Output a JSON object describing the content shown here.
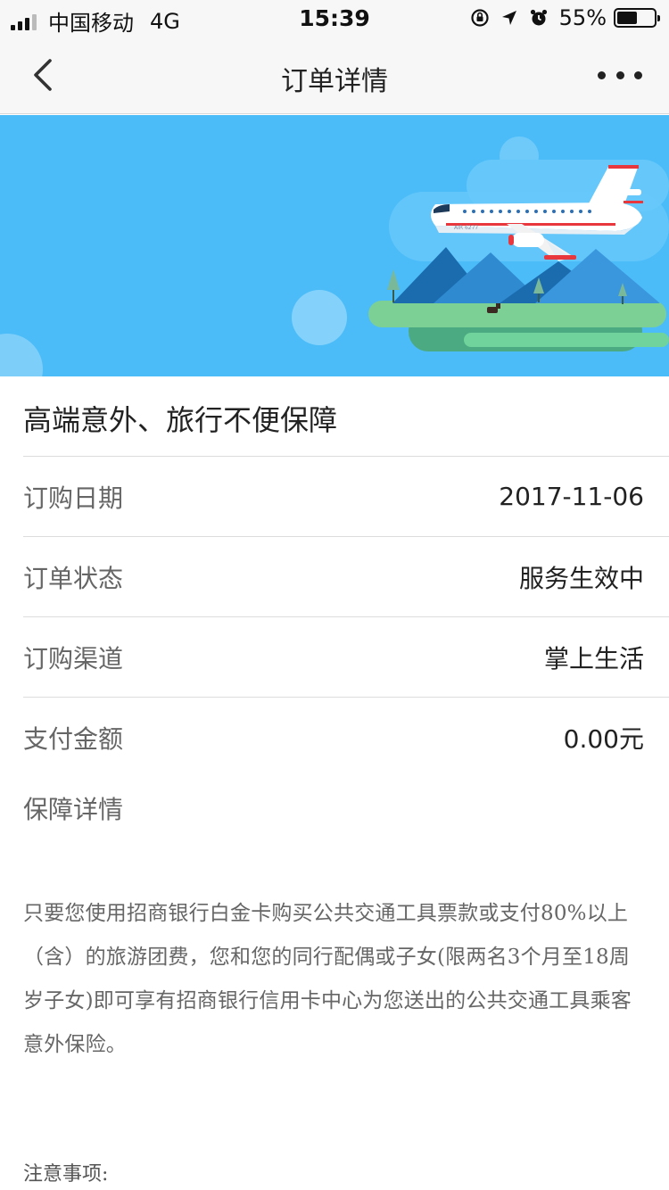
{
  "status_bar": {
    "carrier": "中国移动",
    "network": "4G",
    "time": "15:39",
    "battery_percent": "55%",
    "battery_level": 0.55
  },
  "nav": {
    "title": "订单详情"
  },
  "order": {
    "product_name": "高端意外、旅行不便保障",
    "rows": [
      {
        "label": "订购日期",
        "value": "2017-11-06"
      },
      {
        "label": "订单状态",
        "value": "服务生效中"
      },
      {
        "label": "订购渠道",
        "value": "掌上生活"
      },
      {
        "label": "支付金额",
        "value": "0.00元"
      }
    ],
    "coverage_title": "保障详情",
    "coverage_text": "只要您使用招商银行白金卡购买公共交通工具票款或支付80%以上（含）的旅游团费，您和您的同行配偶或子女(限两名3个月至18周岁子女)即可享有招商银行信用卡中心为您送出的公共交通工具乘客意外保险。",
    "notice_title": "注意事项:"
  },
  "banner": {
    "plane_text": "AIR 6277"
  },
  "colors": {
    "banner_bg": "#4cbcf8",
    "plane_accent": "#e8383d"
  }
}
